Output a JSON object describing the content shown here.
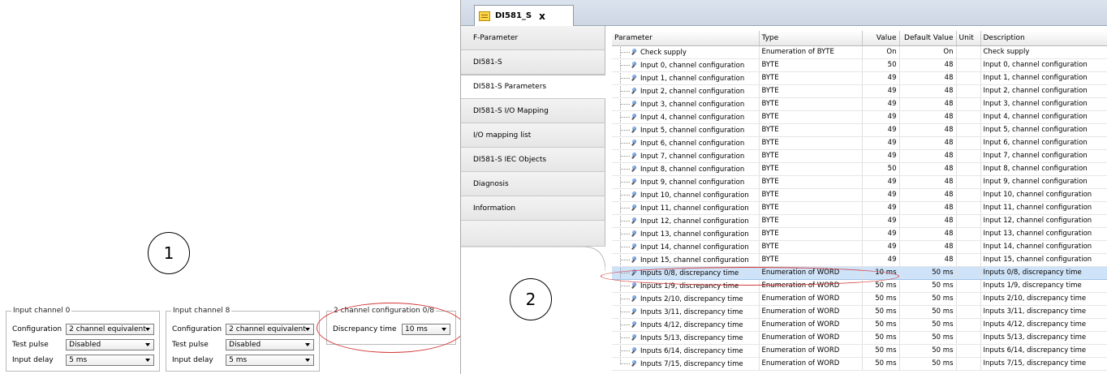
{
  "callouts": {
    "left": "1",
    "right": "2"
  },
  "left_panel": {
    "channel0": {
      "title": "Input channel 0",
      "rows": [
        {
          "label": "Configuration",
          "value": "2 channel equivalent"
        },
        {
          "label": "Test pulse",
          "value": "Disabled"
        },
        {
          "label": "Input delay",
          "value": "5 ms"
        }
      ]
    },
    "channel8": {
      "title": "Input channel 8",
      "rows": [
        {
          "label": "Configuration",
          "value": "2 channel equivalent"
        },
        {
          "label": "Test pulse",
          "value": "Disabled"
        },
        {
          "label": "Input delay",
          "value": "5 ms"
        }
      ]
    },
    "two_channel": {
      "title": "2 channel configuration 0/8",
      "rows": [
        {
          "label": "Discrepancy time",
          "value": "10 ms"
        }
      ]
    }
  },
  "editor": {
    "tab_title": "DI581_S",
    "close_glyph": "x",
    "side_tabs": [
      "F-Parameter",
      "DI581-S",
      "DI581-S Parameters",
      "DI581-S I/O Mapping",
      "I/O mapping list",
      "DI581-S IEC Objects",
      "Diagnosis",
      "Information"
    ],
    "active_tab_index": 2,
    "columns": [
      "Parameter",
      "Type",
      "Value",
      "Default Value",
      "Unit",
      "Description"
    ],
    "rows": [
      [
        "Check supply",
        "Enumeration of BYTE",
        "On",
        "On",
        "",
        "Check supply"
      ],
      [
        "Input 0, channel configuration",
        "BYTE",
        "50",
        "48",
        "",
        "Input 0, channel configuration"
      ],
      [
        "Input 1, channel configuration",
        "BYTE",
        "49",
        "48",
        "",
        "Input 1, channel configuration"
      ],
      [
        "Input 2, channel configuration",
        "BYTE",
        "49",
        "48",
        "",
        "Input 2, channel configuration"
      ],
      [
        "Input 3, channel configuration",
        "BYTE",
        "49",
        "48",
        "",
        "Input 3, channel configuration"
      ],
      [
        "Input 4, channel configuration",
        "BYTE",
        "49",
        "48",
        "",
        "Input 4, channel configuration"
      ],
      [
        "Input 5, channel configuration",
        "BYTE",
        "49",
        "48",
        "",
        "Input 5, channel configuration"
      ],
      [
        "Input 6, channel configuration",
        "BYTE",
        "49",
        "48",
        "",
        "Input 6, channel configuration"
      ],
      [
        "Input 7, channel configuration",
        "BYTE",
        "49",
        "48",
        "",
        "Input 7, channel configuration"
      ],
      [
        "Input 8, channel configuration",
        "BYTE",
        "50",
        "48",
        "",
        "Input 8, channel configuration"
      ],
      [
        "Input 9, channel configuration",
        "BYTE",
        "49",
        "48",
        "",
        "Input 9, channel configuration"
      ],
      [
        "Input 10, channel configuration",
        "BYTE",
        "49",
        "48",
        "",
        "Input 10, channel configuration"
      ],
      [
        "Input 11, channel configuration",
        "BYTE",
        "49",
        "48",
        "",
        "Input 11, channel configuration"
      ],
      [
        "Input 12, channel configuration",
        "BYTE",
        "49",
        "48",
        "",
        "Input 12, channel configuration"
      ],
      [
        "Input 13, channel configuration",
        "BYTE",
        "49",
        "48",
        "",
        "Input 13, channel configuration"
      ],
      [
        "Input 14, channel configuration",
        "BYTE",
        "49",
        "48",
        "",
        "Input 14, channel configuration"
      ],
      [
        "Input 15, channel configuration",
        "BYTE",
        "49",
        "48",
        "",
        "Input 15, channel configuration"
      ],
      [
        "Inputs 0/8, discrepancy time",
        "Enumeration of WORD",
        "10 ms",
        "50 ms",
        "",
        "Inputs 0/8, discrepancy time"
      ],
      [
        "Inputs 1/9, discrepancy time",
        "Enumeration of WORD",
        "50 ms",
        "50 ms",
        "",
        "Inputs 1/9, discrepancy time"
      ],
      [
        "Inputs 2/10, discrepancy time",
        "Enumeration of WORD",
        "50 ms",
        "50 ms",
        "",
        "Inputs 2/10, discrepancy time"
      ],
      [
        "Inputs 3/11, discrepancy time",
        "Enumeration of WORD",
        "50 ms",
        "50 ms",
        "",
        "Inputs 3/11, discrepancy time"
      ],
      [
        "Inputs 4/12, discrepancy time",
        "Enumeration of WORD",
        "50 ms",
        "50 ms",
        "",
        "Inputs 4/12, discrepancy time"
      ],
      [
        "Inputs 5/13, discrepancy time",
        "Enumeration of WORD",
        "50 ms",
        "50 ms",
        "",
        "Inputs 5/13, discrepancy time"
      ],
      [
        "Inputs 6/14, discrepancy time",
        "Enumeration of WORD",
        "50 ms",
        "50 ms",
        "",
        "Inputs 6/14, discrepancy time"
      ],
      [
        "Inputs 7/15, discrepancy time",
        "Enumeration of WORD",
        "50 ms",
        "50 ms",
        "",
        "Inputs 7/15, discrepancy time"
      ]
    ],
    "selected_row_index": 17
  },
  "colors": {
    "selection": "#cfe3f8",
    "highlight_ellipse": "#d43a3a",
    "tab_strip": "#cdd6e3"
  }
}
